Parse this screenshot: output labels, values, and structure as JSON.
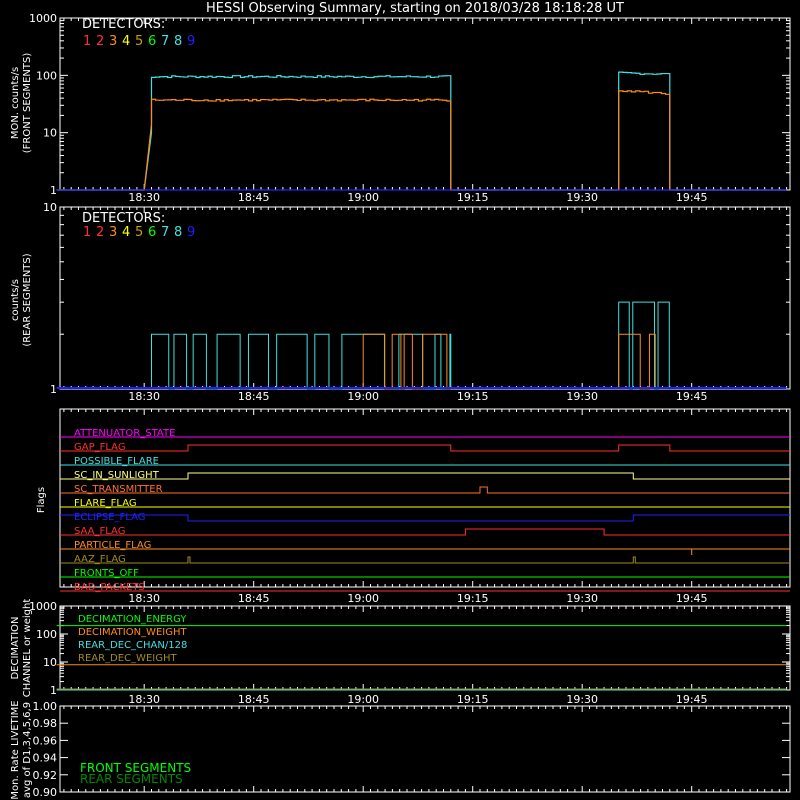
{
  "title": "HESSI Observing Summary, starting on 2018/03/28 18:18:28 UT",
  "colors": {
    "background": "#000000",
    "axes": "#ffffff",
    "detectors": [
      "#ff3030",
      "#ff3030",
      "#ff8c1a",
      "#ffff00",
      "#c8a000",
      "#00ff00",
      "#40e0e0",
      "#40e0e0",
      "#2020ff"
    ]
  },
  "time_axis": {
    "start": "18:18:28",
    "end": "19:58:28",
    "ticks": [
      "18:30",
      "18:45",
      "19:00",
      "19:15",
      "19:30",
      "19:45"
    ]
  },
  "panel1": {
    "ylabel_line1": "MON. counts/s",
    "ylabel_line2": "(FRONT SEGMENTS)",
    "legend_title": "DETECTORS:",
    "legend_numbers": [
      "1",
      "2",
      "3",
      "4",
      "5",
      "6",
      "7",
      "8",
      "9"
    ],
    "yticks": [
      "1",
      "10",
      "100",
      "1000"
    ]
  },
  "panel2": {
    "ylabel_line1": "counts/s",
    "ylabel_line2": "(REAR SEGMENTS)",
    "legend_title": "DETECTORS:",
    "legend_numbers": [
      "1",
      "2",
      "3",
      "4",
      "5",
      "6",
      "7",
      "8",
      "9"
    ],
    "yticks": [
      "1",
      "10"
    ]
  },
  "panel3": {
    "ylabel": "Flags",
    "flags": [
      {
        "name": "ATTENUATOR_STATE",
        "color": "#ff00ff"
      },
      {
        "name": "GAP_FLAG",
        "color": "#ff3030"
      },
      {
        "name": "POSSIBLE_FLARE",
        "color": "#40e0e0"
      },
      {
        "name": "SC_IN_SUNLIGHT",
        "color": "#ffff80"
      },
      {
        "name": "SC_TRANSMITTER",
        "color": "#ff7030"
      },
      {
        "name": "FLARE_FLAG",
        "color": "#ffff00"
      },
      {
        "name": "ECLIPSE_FLAG",
        "color": "#2020ff"
      },
      {
        "name": "SAA_FLAG",
        "color": "#ff3030"
      },
      {
        "name": "PARTICLE_FLAG",
        "color": "#ff8c1a"
      },
      {
        "name": "AAZ_FLAG",
        "color": "#a08a20"
      },
      {
        "name": "FRONTS_OFF",
        "color": "#00ff00"
      },
      {
        "name": "BAD_PACKETS",
        "color": "#ff3030"
      }
    ]
  },
  "panel4": {
    "ylabel_line1": "DECIMATION",
    "ylabel_line2": "CHANNEL or weight",
    "yticks": [
      "1",
      "10",
      "100",
      "1000"
    ],
    "labels": [
      {
        "text": "DECIMATION_ENERGY",
        "color": "#00ff00"
      },
      {
        "text": "DECIMATION_WEIGHT",
        "color": "#ff8c1a"
      },
      {
        "text": "REAR_DEC_CHAN/128",
        "color": "#40e0e0"
      },
      {
        "text": "REAR_DEC_WEIGHT",
        "color": "#a08a20"
      }
    ]
  },
  "panel5": {
    "ylabel_line1": "Mon. Rate LIVETIME",
    "ylabel_line2": "avg of D1,3,4,5,6,9",
    "yticks": [
      "0.90",
      "0.92",
      "0.94",
      "0.96",
      "0.98",
      "1.00"
    ],
    "labels": [
      {
        "text": "FRONT SEGMENTS",
        "color": "#00ff00"
      },
      {
        "text": "REAR SEGMENTS",
        "color": "#008800"
      }
    ]
  },
  "chart_data": [
    {
      "type": "line",
      "title": "HESSI Observing Summary, starting on 2018/03/28 18:18:28 UT",
      "xlabel": "",
      "ylabel": "MON. counts/s (FRONT SEGMENTS)",
      "y_scale": "log",
      "xlim": [
        "18:18:28",
        "19:58:28"
      ],
      "ylim": [
        1,
        1000
      ],
      "series": [
        {
          "name": "8",
          "color": "#40e0e0",
          "x": [
            "18:18",
            "18:30",
            "18:31",
            "18:31",
            "19:12",
            "19:12",
            "19:35",
            "19:35",
            "19:42",
            "19:42",
            "19:58"
          ],
          "y": [
            1,
            1,
            10,
            95,
            95,
            1,
            1,
            110,
            105,
            1,
            1
          ]
        },
        {
          "name": "3",
          "color": "#ff8c1a",
          "x": [
            "18:18",
            "18:30",
            "18:31",
            "18:31",
            "19:12",
            "19:12",
            "19:35",
            "19:35",
            "19:42",
            "19:42",
            "19:58"
          ],
          "y": [
            1,
            1,
            14,
            37,
            37,
            1,
            1,
            55,
            47,
            1,
            1
          ]
        },
        {
          "name": "9",
          "color": "#2020ff",
          "x": [
            "18:18",
            "19:58"
          ],
          "y": [
            1,
            1
          ]
        }
      ]
    },
    {
      "type": "line",
      "title": "",
      "xlabel": "",
      "ylabel": "counts/s (REAR SEGMENTS)",
      "y_scale": "log",
      "xlim": [
        "18:18:28",
        "19:58:28"
      ],
      "ylim": [
        1,
        10
      ],
      "series": [
        {
          "name": "7",
          "color": "#40e0e0",
          "x": [
            "18:31",
            "19:12",
            "19:35",
            "19:42"
          ],
          "y": [
            2,
            2,
            3,
            2
          ]
        },
        {
          "name": "3",
          "color": "#ff8c1a",
          "x": [
            "19:00",
            "19:12",
            "19:35",
            "19:40"
          ],
          "y": [
            2,
            2,
            2,
            2
          ]
        },
        {
          "name": "9",
          "color": "#2020ff",
          "x": [
            "18:18",
            "19:58"
          ],
          "y": [
            1,
            1
          ]
        }
      ]
    },
    {
      "type": "line",
      "title": "",
      "xlabel": "",
      "ylabel": "Flags",
      "series": [
        {
          "name": "GAP_FLAG",
          "x": [
            "18:36",
            "19:12",
            "19:35",
            "19:42"
          ],
          "y": [
            1,
            0,
            1,
            0
          ]
        },
        {
          "name": "SC_IN_SUNLIGHT",
          "x": [
            "18:36",
            "19:37"
          ],
          "y": [
            1,
            0
          ]
        },
        {
          "name": "SC_TRANSMITTER",
          "x": [
            "19:16",
            "19:17"
          ],
          "y": [
            1,
            0
          ]
        },
        {
          "name": "ECLIPSE_FLAG",
          "x": [
            "18:36",
            "19:37"
          ],
          "y": [
            0,
            1
          ]
        },
        {
          "name": "SAA_FLAG",
          "x": [
            "19:14",
            "19:33"
          ],
          "y": [
            1,
            0
          ]
        },
        {
          "name": "PARTICLE_FLAG",
          "x": [
            "19:45"
          ],
          "y": [
            1
          ]
        },
        {
          "name": "AAZ_FLAG",
          "x": [
            "18:36",
            "19:37"
          ],
          "y": [
            1,
            1
          ]
        }
      ]
    },
    {
      "type": "line",
      "title": "",
      "xlabel": "",
      "ylabel": "DECIMATION CHANNEL or weight",
      "y_scale": "log",
      "ylim": [
        1,
        1000
      ],
      "series": [
        {
          "name": "DECIMATION_ENERGY",
          "x": [
            "18:18",
            "19:58"
          ],
          "y": [
            200,
            200
          ]
        },
        {
          "name": "DECIMATION_WEIGHT",
          "x": [
            "18:18",
            "19:58"
          ],
          "y": [
            8,
            8
          ]
        },
        {
          "name": "REAR_DEC_CHAN/128",
          "x": [
            "18:18",
            "19:58"
          ],
          "y": [
            1,
            1
          ]
        },
        {
          "name": "REAR_DEC_WEIGHT",
          "x": [
            "18:18",
            "19:58"
          ],
          "y": [
            1,
            1
          ]
        }
      ]
    },
    {
      "type": "line",
      "title": "",
      "xlabel": "",
      "ylabel": "Mon. Rate LIVETIME avg of D1,3,4,5,6,9",
      "ylim": [
        0.9,
        1.0
      ],
      "series": []
    }
  ]
}
